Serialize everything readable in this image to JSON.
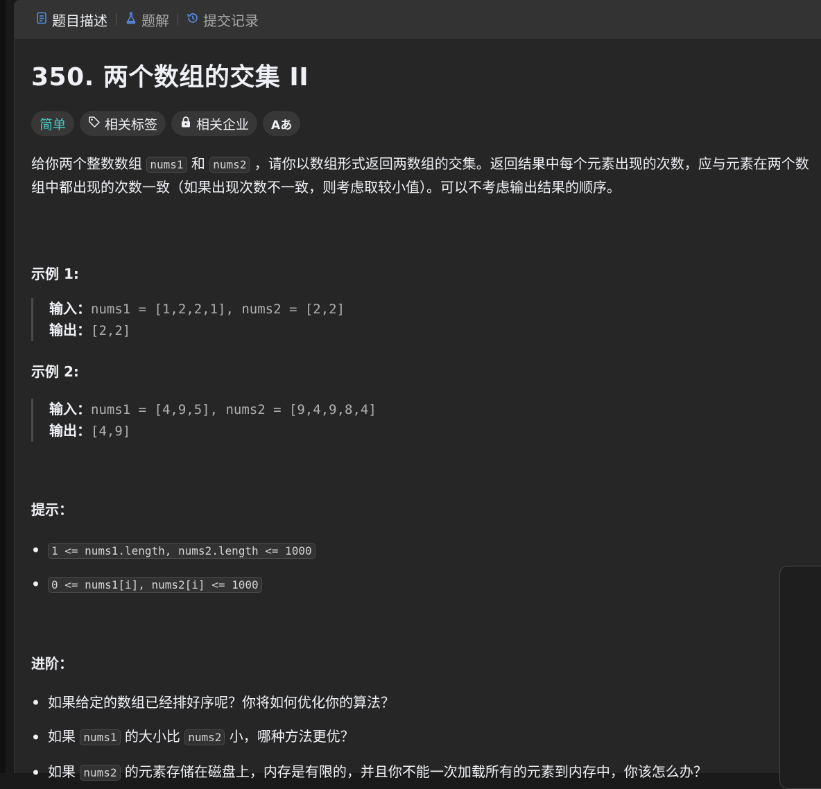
{
  "tabs": [
    {
      "label": "题目描述",
      "icon": "document-icon",
      "active": true
    },
    {
      "label": "题解",
      "icon": "flask-icon",
      "active": false
    },
    {
      "label": "提交记录",
      "icon": "history-icon",
      "active": false
    }
  ],
  "problem": {
    "title": "350. 两个数组的交集 II",
    "tags": [
      {
        "label": "简单",
        "icon": "",
        "color": "#46c6c2"
      },
      {
        "label": "相关标签",
        "icon": "tag-icon"
      },
      {
        "label": "相关企业",
        "icon": "lock-icon"
      },
      {
        "label": "Aあ",
        "icon": "translate-icon"
      }
    ],
    "desc_parts": [
      "给你两个整数数组 ",
      "nums1",
      " 和 ",
      "nums2",
      " ，请你以数组形式返回两数组的交集。返回结果中每个元素出现的次数，应与元素在两个数组中都出现的次数一致（如果出现次数不一致，则考虑取较小值）。可以不考虑输出结果的顺序。"
    ]
  },
  "examples": [
    {
      "heading": "示例 1:",
      "input_label": "输入：",
      "input": "nums1 = [1,2,2,1], nums2 = [2,2]",
      "output_label": "输出：",
      "output": "[2,2]"
    },
    {
      "heading": "示例 2:",
      "input_label": "输入：",
      "input": "nums1 = [4,9,5], nums2 = [9,4,9,8,4]",
      "output_label": "输出：",
      "output": "[4,9]"
    }
  ],
  "hints": {
    "heading": "提示：",
    "items": [
      "1 <= nums1.length, nums2.length <= 1000",
      "0 <= nums1[i], nums2[i] <= 1000"
    ]
  },
  "advanced": {
    "heading": "进阶：",
    "item1": "如果给定的数组已经排好序呢？你将如何优化你的算法？",
    "item2": [
      "如果 ",
      "nums1",
      " 的大小比 ",
      "nums2",
      " 小，哪种方法更优？"
    ],
    "item3": [
      "如果 ",
      "nums2",
      " 的元素存储在磁盘上，内存是有限的，并且你不能一次加载所有的元素到内存中，你该怎么办？"
    ]
  }
}
